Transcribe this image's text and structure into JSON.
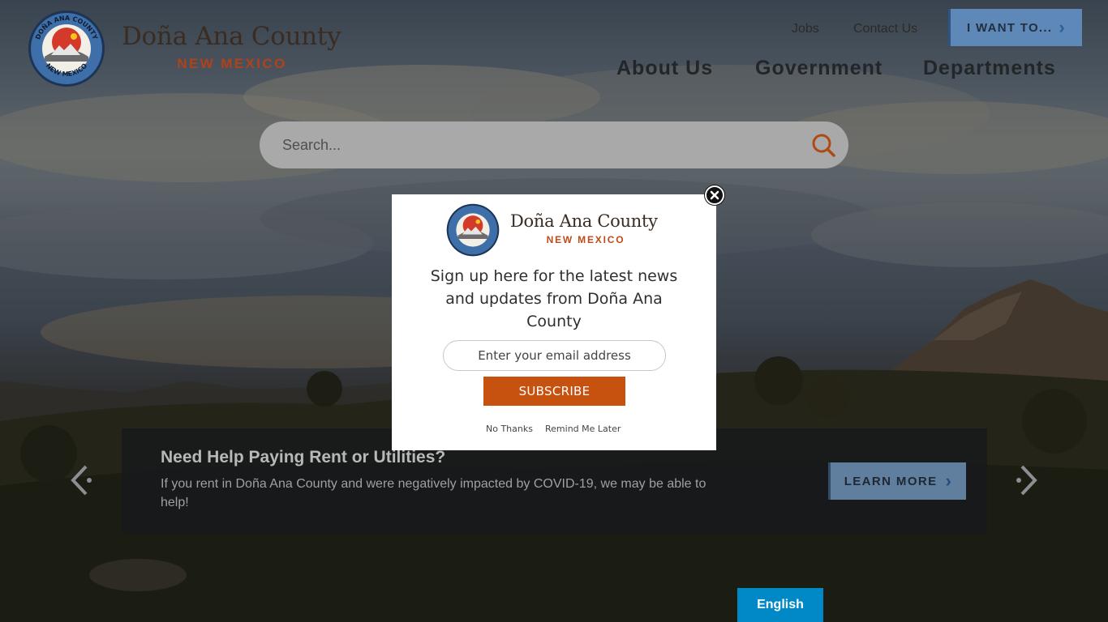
{
  "header": {
    "brand_name": "Doña Ana County",
    "brand_sub": "NEW MEXICO",
    "seal_text_top": "DOÑA ANA COUNTY",
    "seal_text_bottom": "NEW MEXICO",
    "util_links": {
      "jobs": "Jobs",
      "contact": "Contact Us"
    },
    "want_button": "I WANT TO...",
    "nav": {
      "about": "About Us",
      "government": "Government",
      "departments": "Departments"
    }
  },
  "search": {
    "placeholder": "Search...",
    "value": "",
    "icon": "search-icon"
  },
  "banner": {
    "title": "Need Help Paying Rent or Utilities?",
    "text": "If you rent in Doña Ana County and were negatively impacted by COVID-19, we may be able to help!",
    "button": "LEARN MORE"
  },
  "language": {
    "current": "English"
  },
  "popup": {
    "brand_name": "Doña Ana County",
    "brand_sub": "NEW MEXICO",
    "message": "Sign up here for the latest news and updates from Doña Ana County",
    "email_placeholder": "Enter your email address",
    "email_value": "",
    "subscribe": "SUBSCRIBE",
    "no_thanks": "No Thanks",
    "remind_later": "Remind Me Later"
  },
  "colors": {
    "accent_orange": "#c7510f",
    "button_blue": "#5d88b8",
    "language_blue": "#0089c6",
    "brand_text": "#3a2c22"
  }
}
